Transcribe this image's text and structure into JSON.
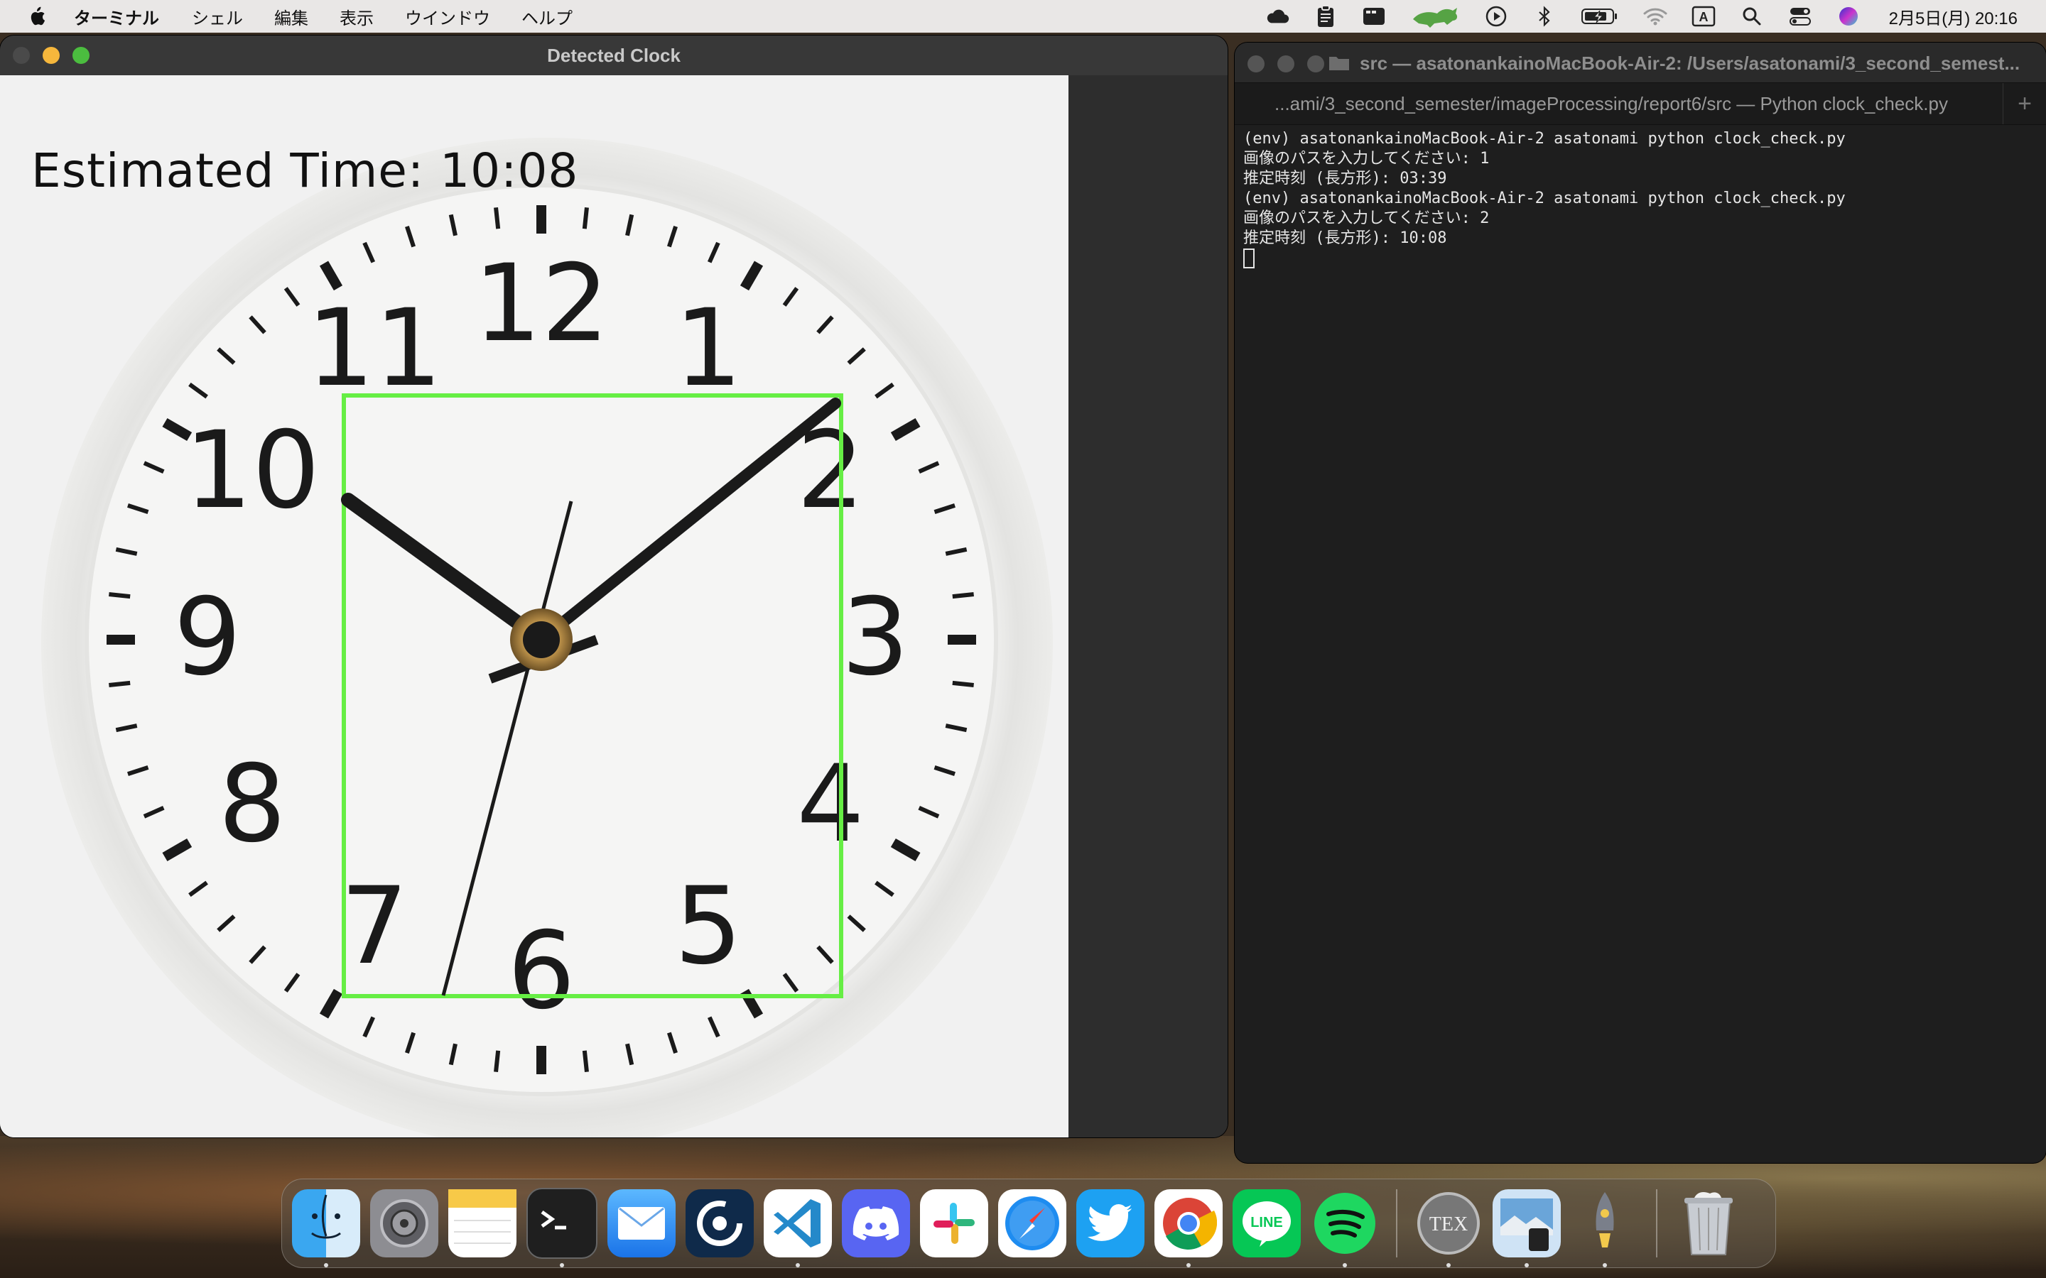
{
  "menubar": {
    "app_name": "ターミナル",
    "items": [
      "シェル",
      "編集",
      "表示",
      "ウインドウ",
      "ヘルプ"
    ],
    "datetime": "2月5日(月) 20:16"
  },
  "clock_window": {
    "title": "Detected Clock",
    "estimated_text": "Estimated Time: 10:08",
    "clock_numbers": [
      "12",
      "1",
      "2",
      "3",
      "4",
      "5",
      "6",
      "7",
      "8",
      "9",
      "10",
      "11"
    ],
    "box_color": "#66ee44"
  },
  "terminal": {
    "title": "src — asatonankainoMacBook-Air-2: /Users/asatonami/3_second_semest...",
    "tab_title": "...ami/3_second_semester/imageProcessing/report6/src — Python clock_check.py",
    "lines": [
      "(env) asatonankainoMacBook-Air-2 asatonami python clock_check.py",
      "画像のパスを入力してください: 1",
      "推定時刻 (長方形): 03:39",
      "(env) asatonankainoMacBook-Air-2 asatonami python clock_check.py",
      "画像のパスを入力してください: 2",
      "推定時刻 (長方形): 10:08"
    ]
  },
  "dock": {
    "apps": [
      "finder-icon",
      "system-settings-icon",
      "notes-icon",
      "terminal-icon",
      "mail-icon",
      "app-6-icon",
      "vscode-icon",
      "discord-icon",
      "slack-icon",
      "safari-icon",
      "twitter-icon",
      "chrome-icon",
      "line-icon",
      "spotify-icon",
      "tex-icon",
      "preview-icon",
      "rocket-icon",
      "trash-icon"
    ],
    "tex_label": "TEX",
    "line_label": "LINE"
  }
}
